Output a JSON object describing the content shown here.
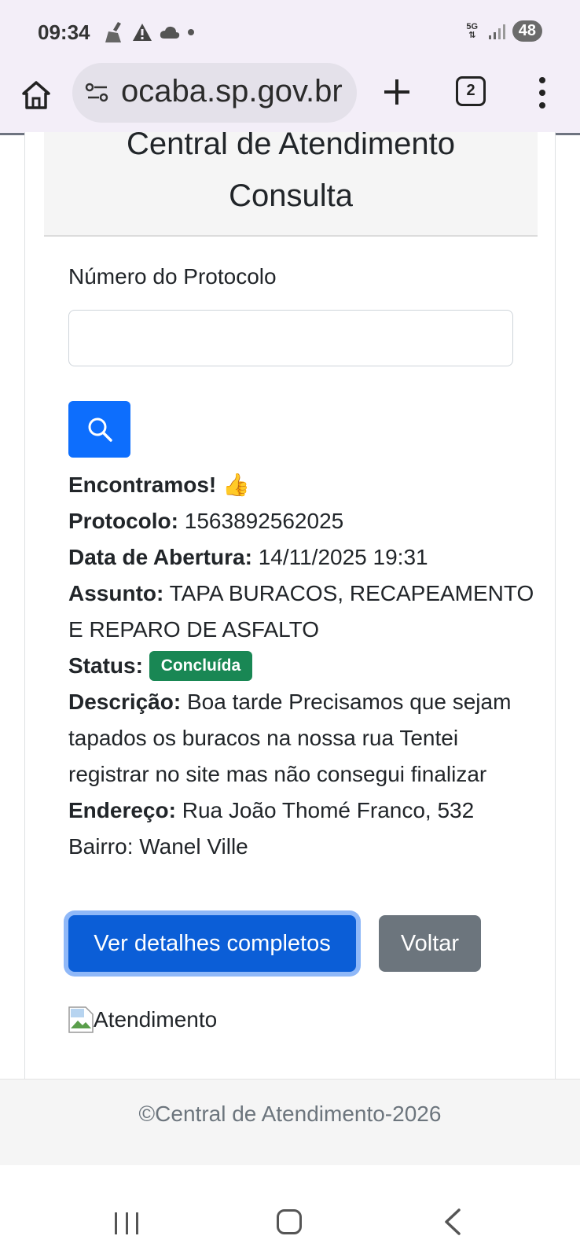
{
  "status_bar": {
    "time": "09:34",
    "network": "5G",
    "battery": "48"
  },
  "browser": {
    "url": "ocaba.sp.gov.br",
    "tab_count": "2"
  },
  "page": {
    "title_line1": "Central de Atendimento",
    "title_line2": "Consulta",
    "protocol_label": "Número do Protocolo",
    "protocol_value": "",
    "found_text": "Encontramos! 👍",
    "protocol": {
      "label": "Protocolo:",
      "value": "1563892562025"
    },
    "opening_date": {
      "label": "Data de Abertura:",
      "value": "14/11/2025 19:31"
    },
    "subject": {
      "label": "Assunto:",
      "value": "TAPA BURACOS, RECAPEAMENTO E REPARO DE ASFALTO"
    },
    "status": {
      "label": "Status:",
      "value": "Concluída"
    },
    "description": {
      "label": "Descrição:",
      "value": "Boa tarde Precisamos que sejam tapados os buracos na nossa rua Tentei registrar no site mas não consegui finalizar"
    },
    "address": {
      "label": "Endereço:",
      "value": "Rua João Thomé Franco, 532"
    },
    "neighborhood": "Bairro: Wanel Ville",
    "details_button": "Ver detalhes completos",
    "back_button": "Voltar",
    "image_alt": "Atendimento",
    "footer": "©Central de Atendimento-2026"
  },
  "colors": {
    "primary": "#0d6efd",
    "success": "#198754",
    "secondary": "#6c757d"
  }
}
